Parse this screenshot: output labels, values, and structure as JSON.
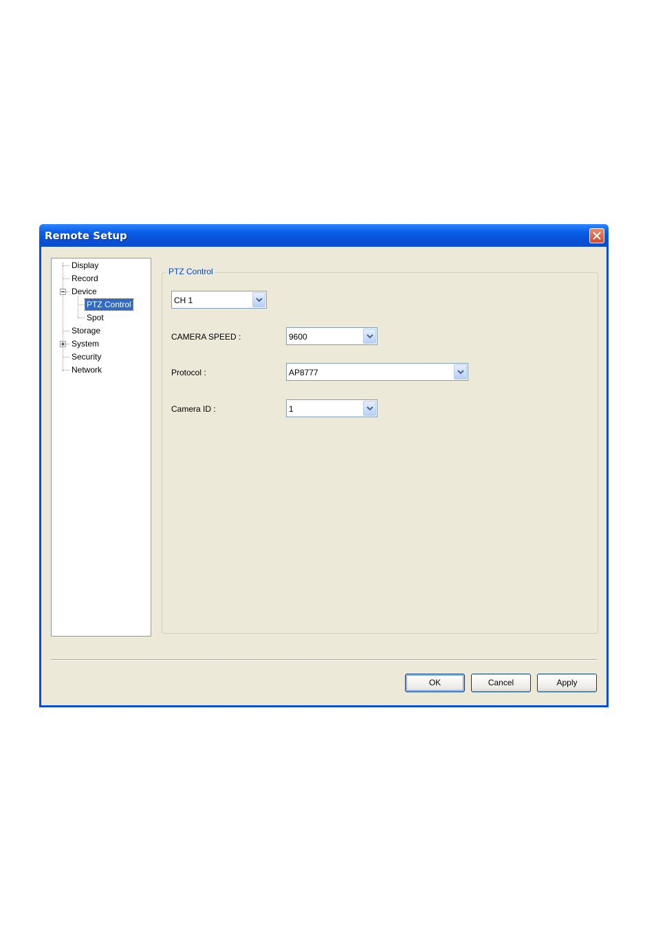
{
  "window": {
    "title": "Remote Setup"
  },
  "tree": {
    "items": [
      {
        "label": "Display"
      },
      {
        "label": "Record"
      },
      {
        "label": "Device",
        "expanded": true
      },
      {
        "label": "PTZ Control",
        "selected": true
      },
      {
        "label": "Spot"
      },
      {
        "label": "Storage"
      },
      {
        "label": "System",
        "expanded": false
      },
      {
        "label": "Security"
      },
      {
        "label": "Network"
      }
    ]
  },
  "ptz": {
    "group_title": "PTZ Control",
    "channel": {
      "value": "CH 1"
    },
    "camera_speed": {
      "label": "CAMERA SPEED :",
      "value": "9600"
    },
    "protocol": {
      "label": "Protocol :",
      "value": "AP8777"
    },
    "camera_id": {
      "label": "Camera ID :",
      "value": "1"
    }
  },
  "buttons": {
    "ok": "OK",
    "cancel": "Cancel",
    "apply": "Apply"
  },
  "colors": {
    "titlebar": "#0b5fe8",
    "client_bg": "#ece9d8",
    "selection": "#316ac5",
    "group_title": "#0046d5"
  }
}
